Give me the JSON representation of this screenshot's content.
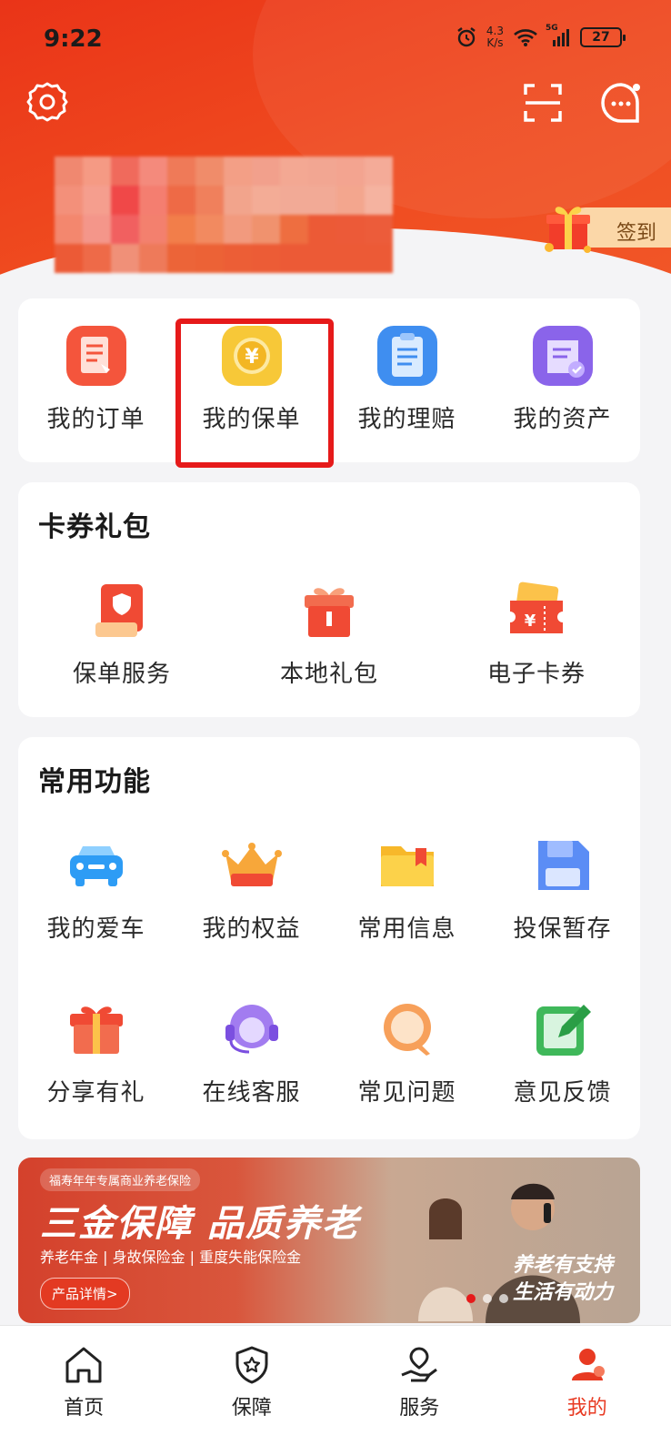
{
  "status_bar": {
    "time": "9:22",
    "net_speed_value": "4.3",
    "net_speed_unit": "K/s",
    "network": "5G",
    "battery": "27"
  },
  "header": {
    "sign_in_label": "签到"
  },
  "quick_actions": [
    {
      "label": "我的订单",
      "icon": "order-icon"
    },
    {
      "label": "我的保单",
      "icon": "policy-coin-icon"
    },
    {
      "label": "我的理赔",
      "icon": "claim-icon"
    },
    {
      "label": "我的资产",
      "icon": "asset-icon"
    }
  ],
  "coupons": {
    "title": "卡券礼包",
    "items": [
      {
        "label": "保单服务",
        "icon": "policy-service-icon"
      },
      {
        "label": "本地礼包",
        "icon": "gift-box-icon"
      },
      {
        "label": "电子卡券",
        "icon": "coupon-icon"
      }
    ]
  },
  "functions": {
    "title": "常用功能",
    "items": [
      {
        "label": "我的爱车",
        "icon": "car-icon"
      },
      {
        "label": "我的权益",
        "icon": "crown-icon"
      },
      {
        "label": "常用信息",
        "icon": "folder-icon"
      },
      {
        "label": "投保暂存",
        "icon": "save-icon"
      },
      {
        "label": "分享有礼",
        "icon": "share-gift-icon"
      },
      {
        "label": "在线客服",
        "icon": "customer-service-icon"
      },
      {
        "label": "常见问题",
        "icon": "faq-icon"
      },
      {
        "label": "意见反馈",
        "icon": "feedback-icon"
      }
    ]
  },
  "banner": {
    "tag": "福寿年年专属商业养老保险",
    "title": "三金保障 品质养老",
    "subtitle": "养老年金 | 身故保险金 | 重度失能保险金",
    "button": "产品详情>",
    "slogan_line1": "养老有支持",
    "slogan_line2": "生活有动力"
  },
  "tabbar": [
    {
      "label": "首页",
      "icon": "home-icon"
    },
    {
      "label": "保障",
      "icon": "shield-star-icon"
    },
    {
      "label": "服务",
      "icon": "service-hand-icon"
    },
    {
      "label": "我的",
      "icon": "profile-icon",
      "active": true
    }
  ],
  "colors": {
    "brand": "#e83a22",
    "highlight": "#e61a1a"
  }
}
